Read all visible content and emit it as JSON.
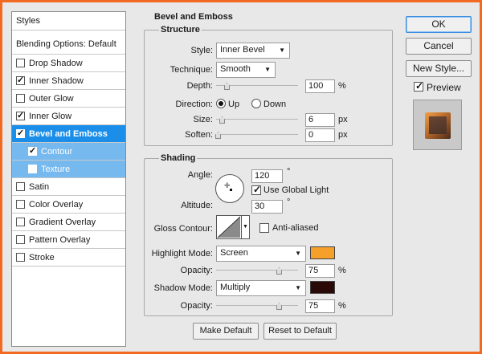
{
  "left_panel": {
    "title": "Styles",
    "blending": "Blending Options: Default",
    "items": [
      {
        "label": "Drop Shadow",
        "checked": false,
        "state": "normal"
      },
      {
        "label": "Inner Shadow",
        "checked": true,
        "state": "normal"
      },
      {
        "label": "Outer Glow",
        "checked": false,
        "state": "normal"
      },
      {
        "label": "Inner Glow",
        "checked": true,
        "state": "normal"
      },
      {
        "label": "Bevel and Emboss",
        "checked": true,
        "state": "selected"
      },
      {
        "label": "Contour",
        "checked": true,
        "state": "sub"
      },
      {
        "label": "Texture",
        "checked": false,
        "state": "sub"
      },
      {
        "label": "Satin",
        "checked": false,
        "state": "normal"
      },
      {
        "label": "Color Overlay",
        "checked": false,
        "state": "normal"
      },
      {
        "label": "Gradient Overlay",
        "checked": false,
        "state": "normal"
      },
      {
        "label": "Pattern Overlay",
        "checked": false,
        "state": "normal"
      },
      {
        "label": "Stroke",
        "checked": false,
        "state": "normal"
      }
    ]
  },
  "bevel": {
    "title": "Bevel and Emboss",
    "structure": {
      "title": "Structure",
      "style_label": "Style:",
      "style_value": "Inner Bevel",
      "technique_label": "Technique:",
      "technique_value": "Smooth",
      "depth_label": "Depth:",
      "depth_value": "100",
      "depth_unit": "%",
      "direction_label": "Direction:",
      "direction_up": "Up",
      "direction_down": "Down",
      "direction_selected": "Up",
      "size_label": "Size:",
      "size_value": "6",
      "size_unit": "px",
      "soften_label": "Soften:",
      "soften_value": "0",
      "soften_unit": "px"
    },
    "shading": {
      "title": "Shading",
      "angle_label": "Angle:",
      "angle_value": "120",
      "angle_unit": "°",
      "global_light_label": "Use Global Light",
      "global_light_checked": true,
      "altitude_label": "Altitude:",
      "altitude_value": "30",
      "altitude_unit": "°",
      "gloss_label": "Gloss Contour:",
      "anti_aliased_label": "Anti-aliased",
      "anti_aliased_checked": false,
      "highlight_mode_label": "Highlight Mode:",
      "highlight_mode_value": "Screen",
      "highlight_color": "#f5a02a",
      "highlight_opacity_label": "Opacity:",
      "highlight_opacity_value": "75",
      "highlight_opacity_unit": "%",
      "shadow_mode_label": "Shadow Mode:",
      "shadow_mode_value": "Multiply",
      "shadow_color": "#2a0a06",
      "shadow_opacity_label": "Opacity:",
      "shadow_opacity_value": "75",
      "shadow_opacity_unit": "%"
    },
    "make_default": "Make Default",
    "reset_default": "Reset to Default"
  },
  "right": {
    "ok": "OK",
    "cancel": "Cancel",
    "new_style": "New Style...",
    "preview_label": "Preview",
    "preview_checked": true
  },
  "colors": {
    "border_accent": "#f26a22",
    "selected": "#1a8ee8",
    "sub_selected": "#75b9ef"
  }
}
